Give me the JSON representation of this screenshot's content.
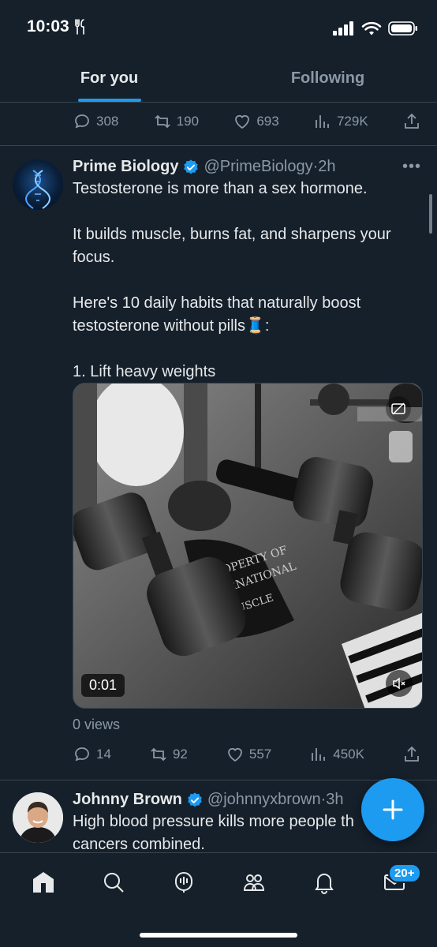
{
  "status_bar": {
    "time": "10:03"
  },
  "tabs": [
    {
      "label": "For you",
      "active": true
    },
    {
      "label": "Following",
      "active": false
    }
  ],
  "top_tweet_actions": {
    "replies": "308",
    "retweets": "190",
    "likes": "693",
    "views": "729K"
  },
  "tweet1": {
    "name": "Prime Biology",
    "handle": "@PrimeBiology",
    "dot": "·",
    "time": "2h",
    "more": "•••",
    "text": "Testosterone is more than a sex hormone.\n\nIt builds muscle, burns fat, and sharpens your focus.\n\nHere's 10 daily habits that naturally boost testosterone without pills🧵:\n\n1. Lift heavy weights",
    "media": {
      "time": "0:01",
      "overlay_text_1": "PROPERTY OF",
      "overlay_text_2": "INTERNATIONAL",
      "overlay_text_3": "MUSCLE"
    },
    "views_label": "0 views",
    "actions": {
      "replies": "14",
      "retweets": "92",
      "likes": "557",
      "views": "450K"
    }
  },
  "tweet2": {
    "name": "Johnny Brown",
    "handle": "@johnnyxbrown",
    "dot": "·",
    "time": "3h",
    "text": "High blood pressure kills more people th\ncancers combined."
  },
  "nav": {
    "messages_badge": "20+"
  },
  "colors": {
    "accent": "#1d9bf0",
    "background": "#15202b",
    "secondary_text": "#8b98a5"
  }
}
